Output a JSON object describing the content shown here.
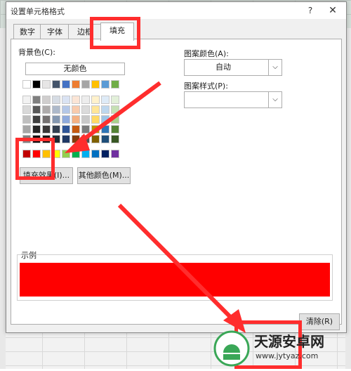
{
  "dialog": {
    "title": "设置单元格格式",
    "help_symbol": "?",
    "close_symbol": "✕"
  },
  "tabs": [
    {
      "label": "数字"
    },
    {
      "label": "字体"
    },
    {
      "label": "边框"
    },
    {
      "label": "填充"
    }
  ],
  "active_tab": "填充",
  "fill": {
    "background_label": "背景色(C):",
    "no_color_label": "无颜色",
    "fill_effects_label": "填充效果(I)...",
    "more_colors_label": "其他颜色(M)...",
    "pattern_color_label": "图案颜色(A):",
    "pattern_color_value": "自动",
    "pattern_style_label": "图案样式(P):",
    "pattern_style_value": ""
  },
  "palette": {
    "theme_row": [
      "#ffffff",
      "#000000",
      "#e7e6e6",
      "#44546a",
      "#4472c4",
      "#ed7d31",
      "#a5a5a5",
      "#ffc000",
      "#5b9bd5",
      "#70ad47"
    ],
    "tint_rows": [
      [
        "#f2f2f2",
        "#7f7f7f",
        "#d0cece",
        "#d6dce4",
        "#dae3f3",
        "#fbe5d6",
        "#ededed",
        "#fff2cc",
        "#deebf7",
        "#e2f0d9"
      ],
      [
        "#d9d9d9",
        "#595959",
        "#aeabab",
        "#adb9ca",
        "#b4c7e7",
        "#f8cbad",
        "#dbdbdb",
        "#ffe699",
        "#bdd7ee",
        "#c5e0b4"
      ],
      [
        "#bfbfbf",
        "#404040",
        "#757171",
        "#8497b0",
        "#8faadc",
        "#f4b183",
        "#c9c9c9",
        "#ffd966",
        "#9dc3e6",
        "#a9d18e"
      ],
      [
        "#a6a6a6",
        "#262626",
        "#3a3838",
        "#333f50",
        "#2f5597",
        "#c55a11",
        "#7b7b7b",
        "#bf9000",
        "#2e75b6",
        "#548235"
      ],
      [
        "#808080",
        "#0d0d0d",
        "#171616",
        "#222a35",
        "#203864",
        "#843c0c",
        "#525252",
        "#7f6000",
        "#1f4e79",
        "#385723"
      ]
    ],
    "standard_row": [
      "#c00000",
      "#ff0000",
      "#ffc000",
      "#ffff00",
      "#92d050",
      "#00b050",
      "#00b0f0",
      "#0070c0",
      "#002060",
      "#7030a0"
    ]
  },
  "sample": {
    "label": "示例",
    "fill_color": "#ff0000"
  },
  "actions": {
    "clear_label": "清除(R)"
  },
  "watermark": {
    "brand": "天源安卓网",
    "url": "www.jytyaz.com"
  },
  "colors": {
    "annotation": "#ff2d2d"
  }
}
